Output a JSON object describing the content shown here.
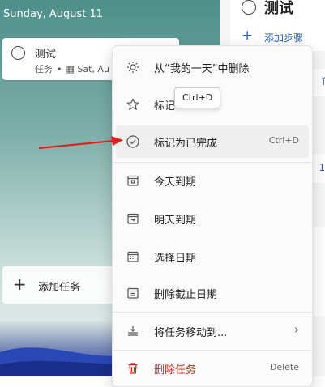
{
  "list": {
    "date_label": "Sunday, August 11",
    "task": {
      "title": "测试",
      "category": "任务",
      "due": "Sat, Au"
    },
    "add_task_label": "添加任务"
  },
  "detail": {
    "title": "测试",
    "add_step_label": "添加步骤"
  },
  "context_menu": {
    "items": [
      {
        "label": "从“我的一天”中删除",
        "shortcut": ""
      },
      {
        "label": "标记",
        "shortcut": ""
      },
      {
        "label": "标记为已完成",
        "shortcut": "Ctrl+D"
      },
      {
        "label": "今天到期",
        "shortcut": ""
      },
      {
        "label": "明天到期",
        "shortcut": ""
      },
      {
        "label": "选择日期",
        "shortcut": ""
      },
      {
        "label": "删除截止日期",
        "shortcut": ""
      },
      {
        "label": "将任务移动到...",
        "shortcut": ""
      },
      {
        "label": "删除任务",
        "shortcut": "Delete"
      }
    ],
    "tooltip": "Ctrl+D"
  },
  "colors": {
    "accent": "#2b5fb4",
    "danger": "#c42b1c",
    "arrow": "#e02020"
  }
}
